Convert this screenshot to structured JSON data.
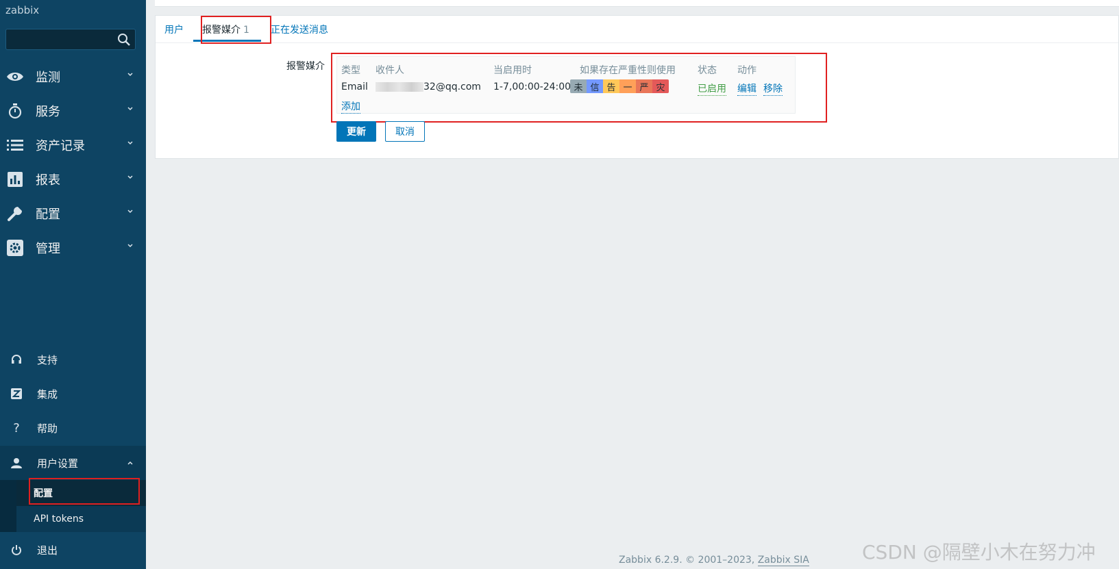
{
  "brand": "zabbix",
  "nav": {
    "monitoring": "监测",
    "services": "服务",
    "inventory": "资产记录",
    "reports": "报表",
    "configuration": "配置",
    "administration": "管理",
    "support": "支持",
    "integrations": "集成",
    "help": "帮助",
    "user_settings": "用户设置",
    "user_settings_items": [
      "配置",
      "API tokens"
    ],
    "signout": "退出"
  },
  "tabs": [
    {
      "label": "用户",
      "active": false
    },
    {
      "label": "报警媒介",
      "count": "1",
      "active": true
    },
    {
      "label": "正在发送消息",
      "active": false
    }
  ],
  "form": {
    "media_label": "报警媒介",
    "columns": [
      "类型",
      "收件人",
      "当启用时",
      "如果存在严重性则使用",
      "状态",
      "动作"
    ],
    "rows": [
      {
        "type": "Email",
        "recipient_suffix": "32@qq.com",
        "when_active": "1-7,00:00-24:00",
        "severities": [
          {
            "label": "未",
            "color": "#97aab3"
          },
          {
            "label": "信",
            "color": "#7499ff"
          },
          {
            "label": "告",
            "color": "#ffc859"
          },
          {
            "label": "一",
            "color": "#ffa059"
          },
          {
            "label": "严",
            "color": "#e97659"
          },
          {
            "label": "灾",
            "color": "#e45959"
          }
        ],
        "status": "已启用",
        "actions": [
          "编辑",
          "移除"
        ]
      }
    ],
    "add_link": "添加",
    "update_button": "更新",
    "cancel_button": "取消"
  },
  "footer": {
    "text": "Zabbix 6.2.9. © 2001–2023,",
    "link": "Zabbix SIA"
  },
  "watermark": "CSDN @隔壁小木在努力冲",
  "colors": {
    "sidebar_bg": "#0e4463",
    "accent": "#0275b8",
    "highlight": "#e02020"
  }
}
